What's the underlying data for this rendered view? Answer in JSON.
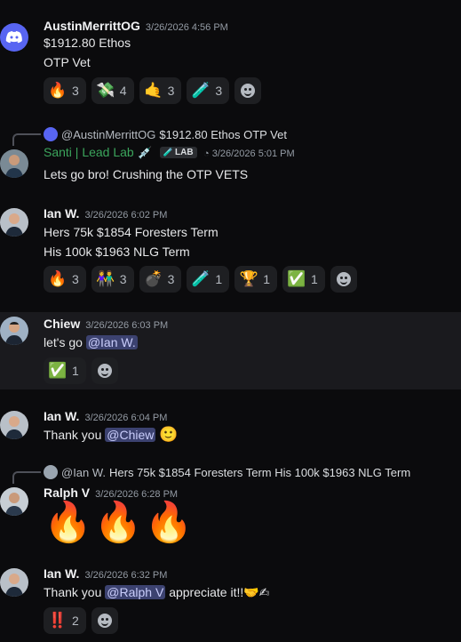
{
  "messages": [
    {
      "author": "AustinMerrittOG",
      "timestamp": "3/26/2026 4:56 PM",
      "lines": [
        "$1912.80 Ethos",
        "OTP Vet"
      ],
      "reactions": [
        {
          "emoji": "🔥",
          "count": "3"
        },
        {
          "emoji": "💸",
          "count": "4"
        },
        {
          "emoji": "🤙",
          "count": "3"
        },
        {
          "emoji": "🧪",
          "count": "3"
        }
      ]
    },
    {
      "reply_to": {
        "author": "@AustinMerrittOG",
        "text": "$1912.80 Ethos  OTP Vet"
      },
      "author": "Santi | Lead Lab",
      "author_color": "#3ba55c",
      "badge": "LAB",
      "timestamp": "3/26/2026 5:01 PM",
      "lines": [
        "Lets go bro! Crushing the OTP VETS"
      ]
    },
    {
      "author": "Ian W.",
      "timestamp": "3/26/2026 6:02 PM",
      "lines": [
        "Hers 75k $1854 Foresters Term",
        "His 100k $1963 NLG Term"
      ],
      "reactions": [
        {
          "emoji": "🔥",
          "count": "3"
        },
        {
          "emoji": "👫",
          "count": "3"
        },
        {
          "emoji": "💣",
          "count": "3"
        },
        {
          "emoji": "🧪",
          "count": "1"
        },
        {
          "emoji": "🏆",
          "count": "1"
        },
        {
          "emoji": "✅",
          "count": "1"
        }
      ]
    },
    {
      "author": "Chiew",
      "timestamp": "3/26/2026 6:03 PM",
      "text": "let's go",
      "mention": "@Ian W.",
      "reactions": [
        {
          "emoji": "✅",
          "count": "1"
        }
      ]
    },
    {
      "author": "Ian W.",
      "timestamp": "3/26/2026 6:04 PM",
      "text": "Thank you",
      "mention": "@Chiew",
      "trail": "🙂"
    },
    {
      "reply_to": {
        "author": "@Ian W.",
        "text": "Hers 75k $1854 Foresters Term His 100k $1963 NLG Term"
      },
      "author": "Ralph V",
      "timestamp": "3/26/2026 6:28 PM",
      "big": "🔥🔥🔥"
    },
    {
      "author": "Ian W.",
      "timestamp": "3/26/2026 6:32 PM",
      "text": "Thank you",
      "mention": "@Ralph V",
      "trail": "appreciate it!!🤝✍",
      "reactions": [
        {
          "emoji": "‼️",
          "count": "2"
        }
      ]
    }
  ],
  "colors": {
    "background": "#0b0b0d",
    "highlight": "#1a1a1e",
    "mention_bg": "#3c4270",
    "accent_green": "#3ba55c"
  }
}
